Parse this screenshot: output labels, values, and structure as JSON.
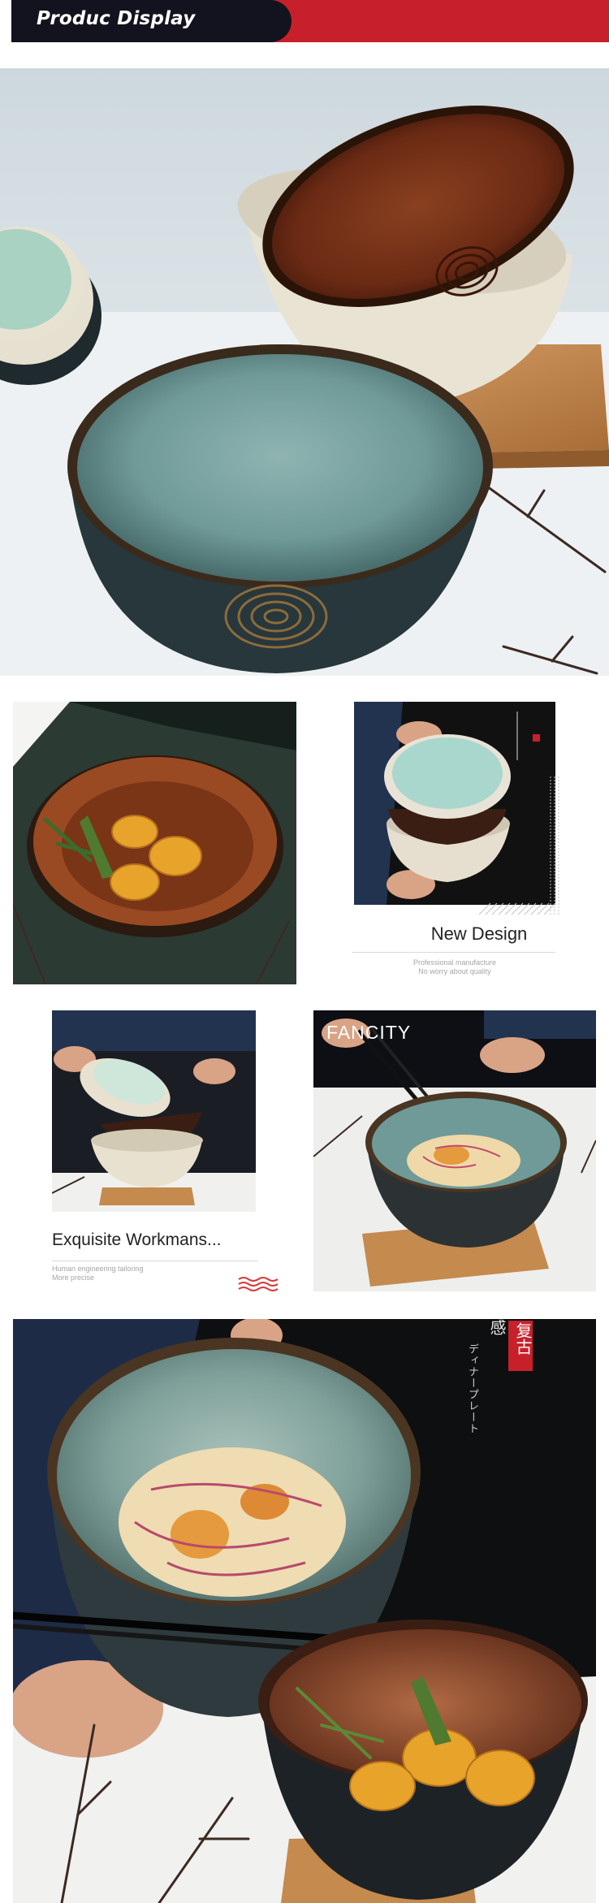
{
  "header": {
    "title": "Produc Display"
  },
  "panels": {
    "new_design": {
      "title": "New Design",
      "subtitle_lines": [
        "Professional manufacture",
        "No worry about quality"
      ]
    },
    "workmanship": {
      "title": "Exquisite Workmans...",
      "subtitle_lines": [
        "Human engineering tailoring",
        "More precise"
      ]
    },
    "fancity": {
      "label": "FANCITY"
    },
    "retro": {
      "seal_text": "复古",
      "kanji_text": "感",
      "vertical_text": "ディナープレート"
    }
  },
  "colors": {
    "banner_dark": "#13131f",
    "banner_red": "#c8202a",
    "seal_red": "#c8202a",
    "glaze_green": "#6f9a98",
    "glaze_brown": "#6b2a14",
    "wood": "#c48a4e"
  }
}
